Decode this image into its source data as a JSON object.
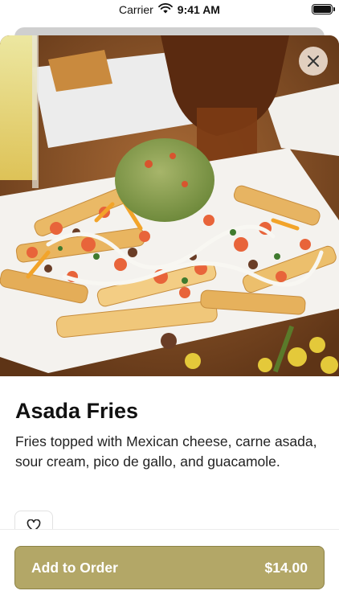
{
  "status_bar": {
    "carrier": "Carrier",
    "time": "9:41 AM"
  },
  "hero": {
    "image_description_icon": "food-photo",
    "close_icon": "close-icon"
  },
  "item": {
    "title": "Asada Fries",
    "description": "Fries topped with Mexican cheese, carne asada, sour cream, pico de gallo, and guacamole."
  },
  "favorite": {
    "icon": "heart-icon"
  },
  "order": {
    "label": "Add to Order",
    "price": "$14.00"
  },
  "colors": {
    "order_button": "#b3a767",
    "order_button_border": "#8c8246"
  }
}
